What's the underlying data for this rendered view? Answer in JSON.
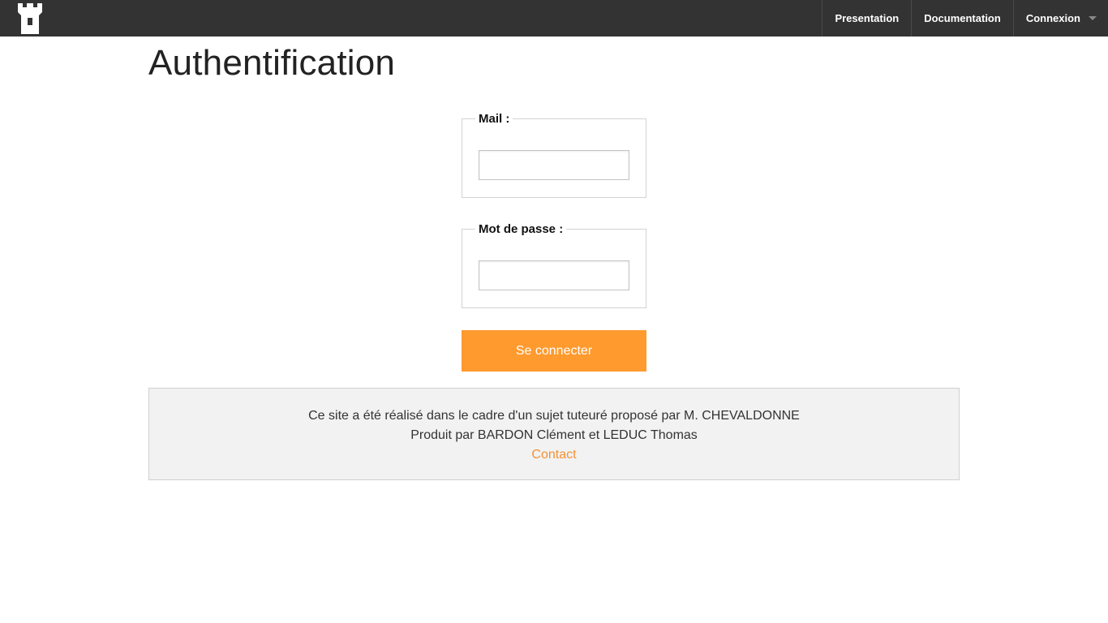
{
  "header": {
    "logo_icon": "castle-tower-icon",
    "nav": [
      {
        "label": "Presentation"
      },
      {
        "label": "Documentation"
      },
      {
        "label": "Connexion",
        "icon": "chevron-down-icon"
      }
    ]
  },
  "page": {
    "title": "Authentification"
  },
  "form": {
    "mail_legend": "Mail :",
    "mail_value": "",
    "password_legend": "Mot de passe :",
    "password_value": "",
    "submit_label": "Se connecter"
  },
  "footer": {
    "line1": "Ce site a été réalisé dans le cadre d'un sujet tuteuré proposé par M. CHEVALDONNE",
    "line2": "Produit par BARDON Clément et LEDUC Thomas",
    "contact_label": "Contact"
  },
  "colors": {
    "topbar": "#333333",
    "accent": "#ff9a2e",
    "footer_bg": "#f2f2f2"
  }
}
